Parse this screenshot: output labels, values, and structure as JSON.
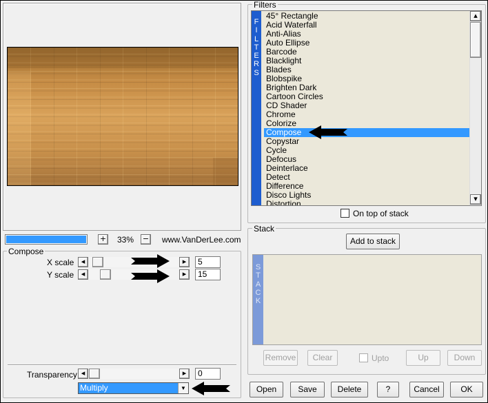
{
  "preview": {
    "zoom_minus": "−",
    "zoom_plus": "+",
    "zoom_level": "33%",
    "website": "www.VanDerLee.com",
    "progress_fraction": 1.0
  },
  "compose": {
    "group_title": "Compose",
    "x_scale_label": "X scale",
    "x_scale_value": "5",
    "y_scale_label": "Y scale",
    "y_scale_value": "15",
    "transparency_label": "Transparency",
    "transparency_value": "0",
    "blend_mode": "Multiply"
  },
  "filters": {
    "group_title": "Filters",
    "banner": [
      "F",
      "I",
      "L",
      "T",
      "E",
      "R",
      "S"
    ],
    "items": [
      "45° Rectangle",
      "Acid Waterfall",
      "Anti-Alias",
      "Auto Ellipse",
      "Barcode",
      "Blacklight",
      "Blades",
      "Blobspike",
      "Brighten Dark",
      "Cartoon Circles",
      "CD Shader",
      "Chrome",
      "Colorize",
      "Compose",
      "Copystar",
      "Cycle",
      "Defocus",
      "Deinterlace",
      "Detect",
      "Difference",
      "Disco Lights",
      "Distortion"
    ],
    "selected": "Compose",
    "on_top_label": "On top of stack"
  },
  "stack": {
    "group_title": "Stack",
    "add_label": "Add to stack",
    "banner": [
      "S",
      "T",
      "A",
      "C",
      "K"
    ],
    "remove_label": "Remove",
    "clear_label": "Clear",
    "upto_label": "Upto",
    "up_label": "Up",
    "down_label": "Down"
  },
  "buttons": {
    "open": "Open",
    "save": "Save",
    "delete": "Delete",
    "help": "?",
    "cancel": "Cancel",
    "ok": "OK"
  },
  "icons": {
    "scroll_left": "◂",
    "scroll_right": "▸",
    "scroll_up": "▴",
    "scroll_down": "▾",
    "dropdown": "▼"
  },
  "colors": {
    "selection": "#3399ff",
    "filter_banner": "#1e5dcf",
    "stack_banner": "#7c9ad9",
    "list_background": "#ebe8da"
  }
}
